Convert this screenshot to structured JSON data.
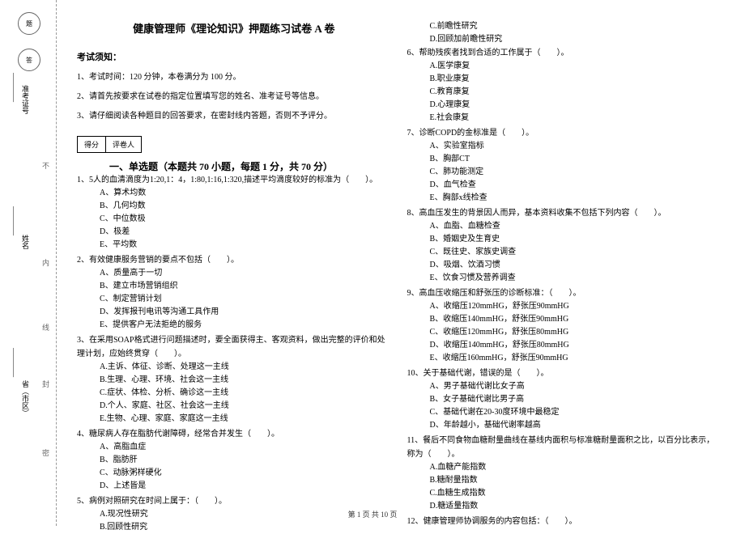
{
  "binding": {
    "stamp_top": "题",
    "stamp_bottom": "答",
    "label_ticket": "准考证号",
    "label_name": "姓名",
    "label_region": "省（市区）",
    "mark_no": "不",
    "mark_inside": "内",
    "mark_line": "线",
    "mark_seal": "封",
    "mark_secret": "密"
  },
  "header": {
    "title": "健康管理师《理论知识》押题练习试卷 A 卷",
    "notice_title": "考试须知：",
    "notices": [
      "1、考试时间：120 分钟，本卷满分为 100 分。",
      "2、请首先按要求在试卷的指定位置填写您的姓名、准考证号等信息。",
      "3、请仔细阅读各种题目的回答要求，在密封线内答题，否则不予评分。"
    ]
  },
  "score_box": {
    "col1": "得分",
    "col2": "评卷人"
  },
  "section": {
    "title": "一、单选题（本题共 70 小题，每题 1 分，共 70 分）"
  },
  "questions_left": [
    {
      "stem": "1、5人的血清滴度为1:20,1：4，1:80,1:16,1:320,描述平均滴度较好的标准为（　　）。",
      "options": [
        "A、算术均数",
        "B、几何均数",
        "C、中位数极",
        "D、极差",
        "E、平均数"
      ]
    },
    {
      "stem": "2、有效健康服务营销的要点不包括（　　）。",
      "options": [
        "A、质量高于一切",
        "B、建立市场营销组织",
        "C、制定营销计划",
        "D、发挥报刊电讯等沟通工具作用",
        "E、提供客户无法拒绝的服务"
      ]
    },
    {
      "stem": "3、在采用SOAP格式进行问题描述时，要全面获得主、客观资料，做出完整的评价和处理计划，应始终贯穿（　　）。",
      "options": [
        "A.主诉、体征、诊断、处理这一主线",
        "B.生理、心理、环境、社会这一主线",
        "C.症状、体检、分析、确诊这一主线",
        "D.个人、家庭、社区、社会这一主线",
        "E.生物、心理、家庭、家庭这一主线"
      ]
    },
    {
      "stem": "4、糖尿病人存在脂肪代谢障碍，经常合并发生（　　）。",
      "options": [
        "A、高脂血症",
        "B、脂肪肝",
        "C、动脉粥样硬化",
        "D、上述皆是"
      ]
    },
    {
      "stem": "5、病例对照研究在时间上属于：（　　）。",
      "options": [
        "A.现况性研究",
        "B.回顾性研究"
      ]
    }
  ],
  "questions_right_continue": [
    "C.前瞻性研究",
    "D.回顾加前瞻性研究"
  ],
  "questions_right": [
    {
      "stem": "6、帮助残疾者找到合适的工作属于（　　）。",
      "options": [
        "A.医学康复",
        "B.职业康复",
        "C.教育康复",
        "D.心理康复",
        "E.社会康复"
      ]
    },
    {
      "stem": "7、诊断COPD的金标准是（　　）。",
      "options": [
        "A、实验室指标",
        "B、胸部CT",
        "C、肺功能测定",
        "D、血气检查",
        "E、胸部x线检查"
      ]
    },
    {
      "stem": "8、高血压发生的背景因人而异，基本资料收集不包括下列内容（　　）。",
      "options": [
        "A、血脂、血糖检查",
        "B、婚姻史及生育史",
        "C、既往史、家族史调查",
        "D、吸烟、饮酒习惯",
        "E、饮食习惯及营养调查"
      ]
    },
    {
      "stem": "9、高血压收缩压和舒张压的诊断标准：（　　）。",
      "options": [
        "A、收缩压120mmHG，舒张压90mmHG",
        "B、收缩压140mmHG，舒张压90mmHG",
        "C、收缩压120mmHG，舒张压80mmHG",
        "D、收缩压140mmHG，舒张压80mmHG",
        "E、收缩压160mmHG，舒张压90mmHG"
      ]
    },
    {
      "stem": "10、关于基础代谢，错误的是（　　）。",
      "options": [
        "A、男子基础代谢比女子高",
        "B、女子基础代谢比男子高",
        "C、基础代谢在20-30度环境中最稳定",
        "D、年龄越小，基础代谢率越高"
      ]
    },
    {
      "stem": "11、餐后不同食物血糖耐量曲线在基线内面积与标准糖耐量面积之比，以百分比表示，称为（　　）。",
      "options": [
        "A.血糖产能指数",
        "B.糖耐量指数",
        "C.血糖生成指数",
        "D.糖适量指数"
      ]
    },
    {
      "stem": "12、健康管理师协调服务的内容包括：（　　）。",
      "options": []
    }
  ],
  "footer": "第 1 页 共 10 页"
}
